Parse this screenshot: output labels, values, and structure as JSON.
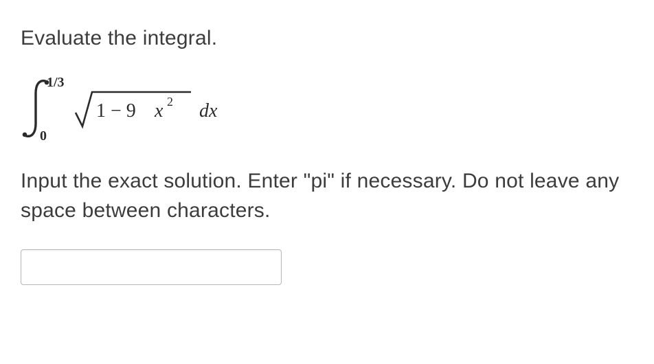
{
  "question": {
    "prompt": "Evaluate the integral.",
    "integral": {
      "lower_limit": "0",
      "upper_limit": "1/3",
      "radicand_prefix": "1 − 9",
      "radicand_var": "x",
      "radicand_exp": "2",
      "differential": "dx"
    },
    "instructions": "Input the exact solution. Enter \"pi\" if necessary. Do not leave any space between characters."
  },
  "answer_input": {
    "value": "",
    "placeholder": ""
  }
}
